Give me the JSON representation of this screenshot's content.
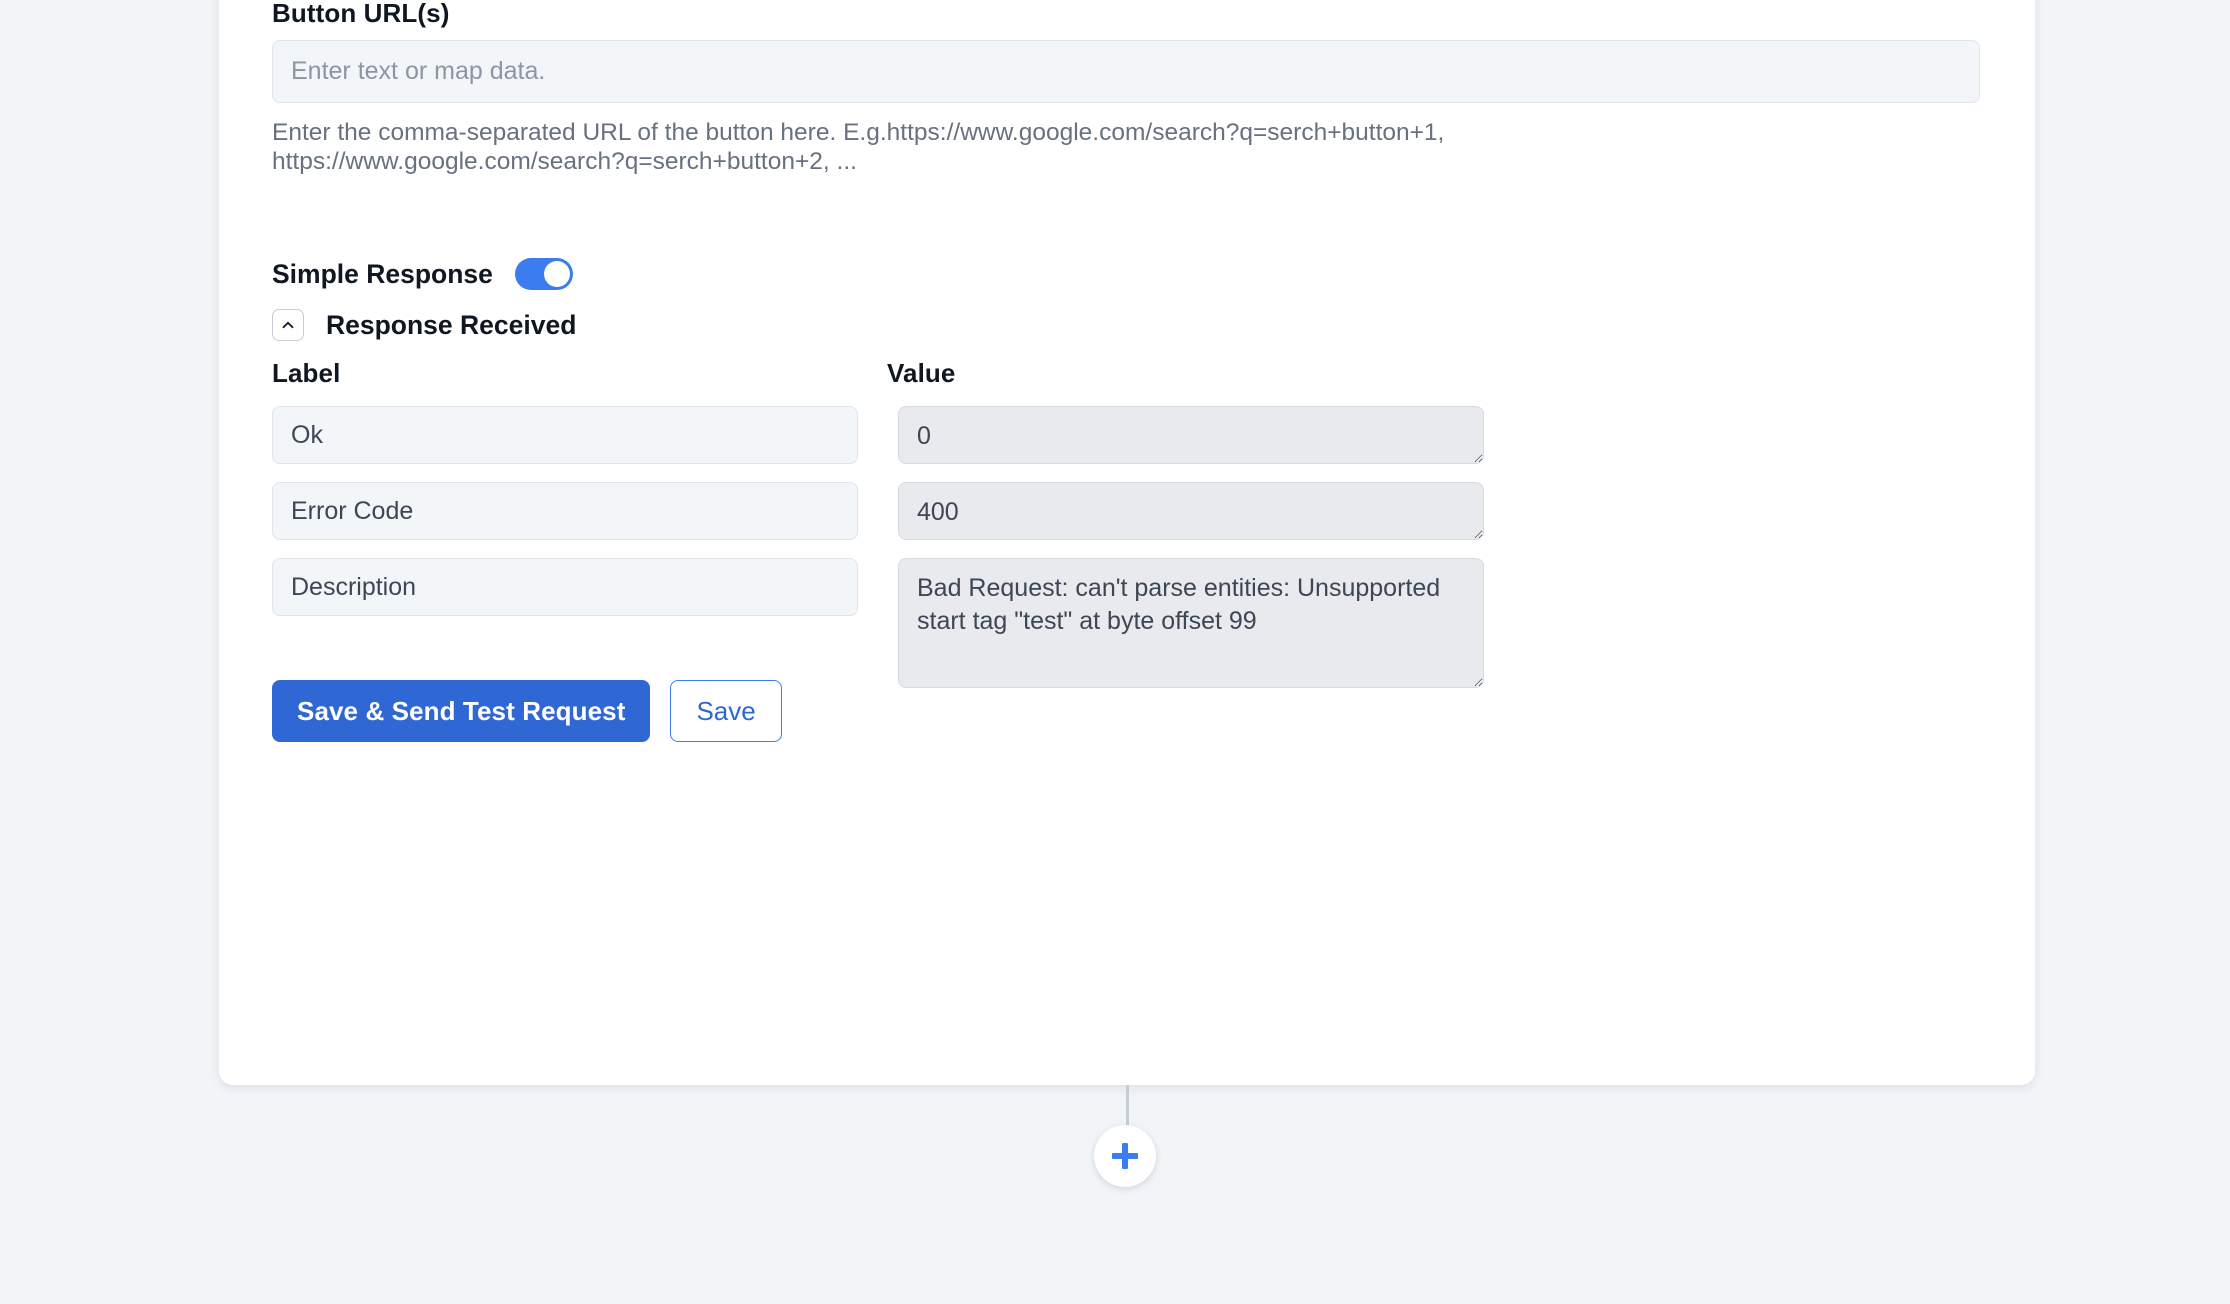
{
  "card": {
    "url_field": {
      "label": "Button URL(s)",
      "value": "",
      "placeholder": "Enter text or map data.",
      "help_text": "Enter the comma-separated URL of the button here. E.g.https://www.google.com/search?q=serch+button+1, https://www.google.com/search?q=serch+button+2, ..."
    },
    "simple_response": {
      "label": "Simple Response",
      "enabled": true
    },
    "response_section": {
      "title": "Response Received",
      "expanded": true,
      "chevron_icon": "chevron-up-icon",
      "columns": {
        "label": "Label",
        "value": "Value"
      },
      "rows": [
        {
          "label": "Ok",
          "value": "0"
        },
        {
          "label": "Error Code",
          "value": "400"
        },
        {
          "label": "Description",
          "value": "Bad Request: can't parse entities: Unsupported start tag \"test\" at byte offset 99"
        }
      ]
    },
    "actions": {
      "primary": "Save & Send Test Request",
      "secondary": "Save"
    }
  },
  "flow": {
    "add_node_button": {
      "icon": "plus-icon",
      "label": "+"
    }
  },
  "colors": {
    "page_background": "#f1f5f8",
    "card_background": "#ffffff",
    "accent_blue": "#3b7df0",
    "primary_button": "#2f68d4",
    "input_background": "#f2f6f9",
    "textarea_background": "#e8eaee",
    "text_primary": "#0f1722",
    "text_secondary": "#67717f",
    "text_input": "#3d4654"
  }
}
